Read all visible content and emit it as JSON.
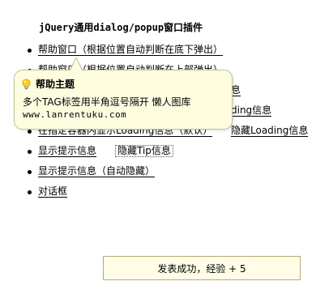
{
  "page": {
    "title": "jQuery通用dialog/popup窗口插件"
  },
  "items": [
    {
      "link1": "帮助窗口（根据位置自动判断在底下弹出）"
    },
    {
      "link1": "帮助窗口（根据位置自动判断在上部弹出）"
    },
    {
      "link1": "显示",
      "link2": "息"
    },
    {
      "link1": "",
      "link2": "ding信息"
    },
    {
      "link1": "在指定容器内显示Loading信息（默认）",
      "link2": "隐藏Loading信息"
    },
    {
      "link1": "显示提示信息",
      "link2": "隐藏Tip信息"
    },
    {
      "link1": "显示提示信息（自动隐藏）"
    },
    {
      "link1": "对话框"
    }
  ],
  "tooltip": {
    "icon": "lightbulb-icon",
    "title": "帮助主题",
    "body": "多个TAG标签用半角逗号隔开 懒人图库",
    "url": "www.lanrentuku.com"
  },
  "toast": {
    "message": "发表成功，经验 + 5"
  },
  "colors": {
    "tooltip_bg": "#fffde0",
    "tooltip_border": "#c8c29a",
    "toast_bg": "#fffde6",
    "toast_border": "#b5aa7a"
  }
}
